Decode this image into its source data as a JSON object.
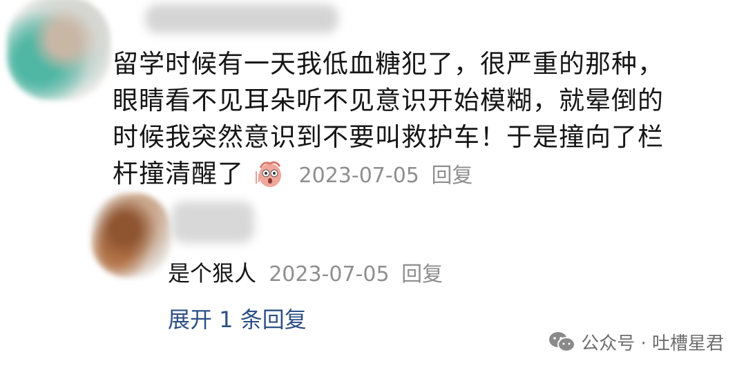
{
  "comment": {
    "lines": [
      "留学时候有一天我低血糖犯了，很严重的那种，",
      "眼睛看不见耳朵听不见意识开始模糊，就晕倒的",
      "时候我突然意识到不要叫救护车！于是撞向了栏",
      "杆撞清醒了"
    ],
    "emoji": "shocked-face-emoji",
    "date": "2023-07-05",
    "reply_label": "回复"
  },
  "reply": {
    "text": "是个狠人",
    "date": "2023-07-05",
    "reply_label": "回复"
  },
  "expand_label": "展开 1 条回复",
  "watermark": {
    "icon": "wechat-icon",
    "text": "公众号 · 吐槽星君"
  }
}
